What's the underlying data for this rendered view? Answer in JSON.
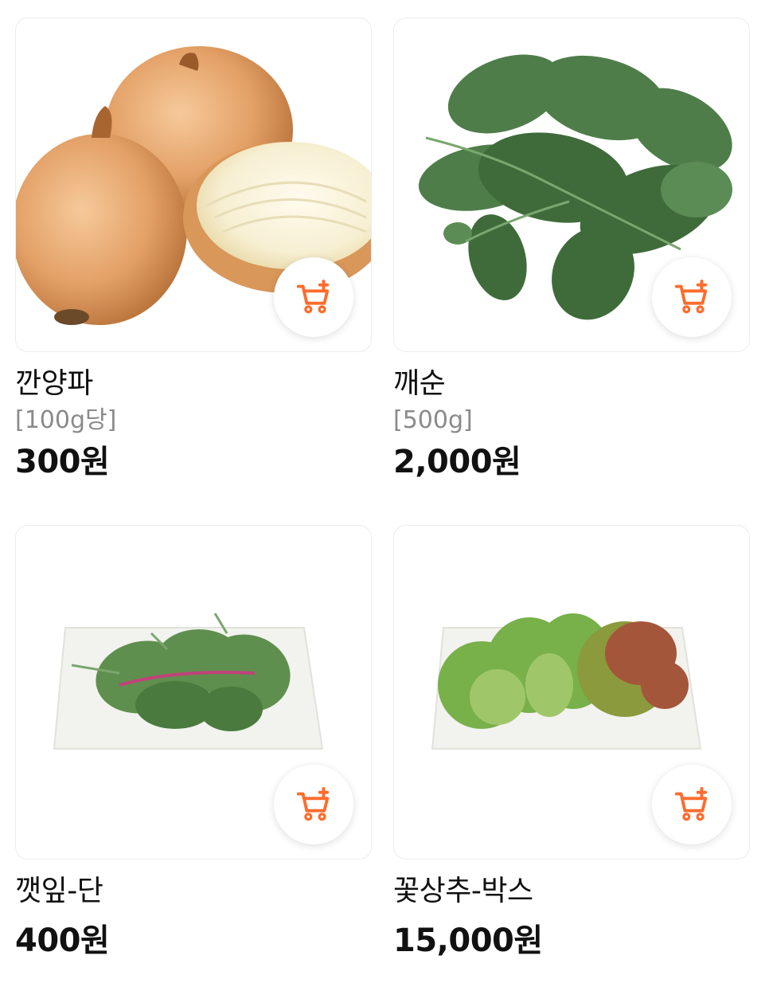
{
  "products": [
    {
      "name": "깐양파",
      "unit": "[100g당]",
      "price": "300원"
    },
    {
      "name": "깨순",
      "unit": "[500g]",
      "price": "2,000원"
    },
    {
      "name": "깻잎-단",
      "price": "400원"
    },
    {
      "name": "꽃상추-박스",
      "price": "15,000원"
    }
  ],
  "theme": {
    "accent": "#FF6B2C",
    "price_color": "#111111",
    "unit_color": "#8A8A8A",
    "card_border": "#ECECEC"
  },
  "icons": {
    "cart_add": "cart-plus-icon"
  }
}
